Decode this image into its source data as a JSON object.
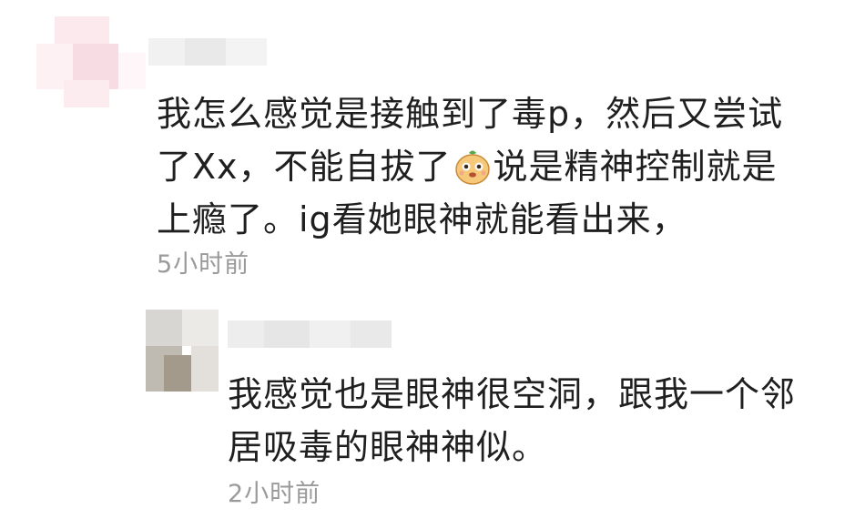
{
  "comments": [
    {
      "lines": [
        "我怎么感觉是接触到了毒p，然后又尝试",
        "了Xx，不能自拔了",
        "说是精神控制就是",
        "上瘾了。ig看她眼神就能看出来，"
      ],
      "emoji": "smiling-face-emoji",
      "time": "5小时前"
    }
  ],
  "replies": [
    {
      "lines": [
        "我感觉也是眼神很空洞，跟我一个邻",
        "居吸毒的眼神神似。"
      ],
      "time": "2小时前"
    }
  ]
}
